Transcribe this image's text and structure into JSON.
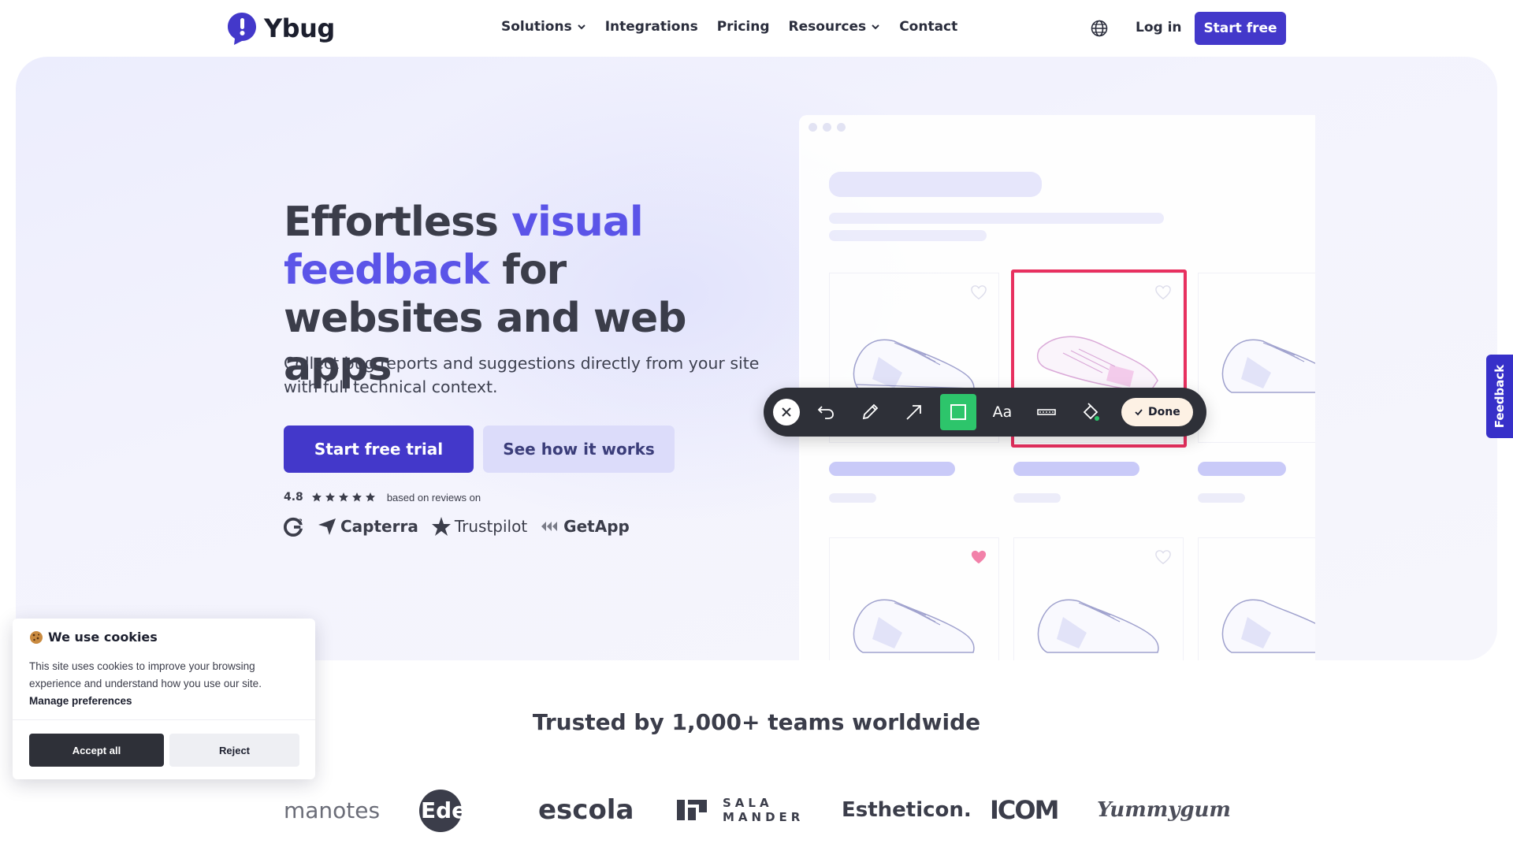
{
  "brand": {
    "name": "Ybug",
    "accent": "#4338ca",
    "highlight": "#5b54e8"
  },
  "nav": {
    "items": [
      {
        "label": "Solutions",
        "has_dropdown": true
      },
      {
        "label": "Integrations",
        "has_dropdown": false
      },
      {
        "label": "Pricing",
        "has_dropdown": false
      },
      {
        "label": "Resources",
        "has_dropdown": true
      },
      {
        "label": "Contact",
        "has_dropdown": false
      }
    ],
    "language_icon": "globe-icon",
    "login_label": "Log in",
    "cta_label": "Start free"
  },
  "hero": {
    "title_part1": "Effortless ",
    "title_accent": "visual feedback",
    "title_part2": " for websites and web apps",
    "subtitle": "Collect bug reports and suggestions directly from your site with full technical context.",
    "primary_cta": "Start free trial",
    "secondary_cta": "See how it works",
    "rating": {
      "score": "4.8",
      "stars": 5,
      "text": "based on reviews on"
    },
    "review_sites": [
      "G2",
      "Capterra",
      "Trustpilot",
      "GetApp"
    ]
  },
  "annotation_toolbar": {
    "tools": [
      "close-icon",
      "undo-icon",
      "pencil-icon",
      "arrow-icon",
      "rectangle-icon",
      "text-tool",
      "blur-icon",
      "color-fill-icon"
    ],
    "text_tool_label": "Aa",
    "active_tool": "rectangle-icon",
    "done_label": "Done",
    "active_color": "#2dc56b",
    "highlight_color": "#e8305f"
  },
  "feedback_tab": {
    "label": "Feedback"
  },
  "trusted": {
    "heading": "Trusted by 1,000+ teams worldwide",
    "logos": [
      {
        "name": "manotes",
        "text": "manotes"
      },
      {
        "name": "edenred",
        "text": "Edenred"
      },
      {
        "name": "escola",
        "text": "escola"
      },
      {
        "name": "salamander",
        "line1": "SALA",
        "line2": "MANDER"
      },
      {
        "name": "estheticon",
        "text": "Estheticon."
      },
      {
        "name": "icom",
        "text": "ICOM"
      },
      {
        "name": "yummygum",
        "text": "Yummygum"
      }
    ]
  },
  "cookie": {
    "title": "We use cookies",
    "body": "This site uses cookies to improve your browsing experience and understand how you use our site.",
    "manage_label": "Manage preferences",
    "accept_label": "Accept all",
    "reject_label": "Reject"
  }
}
